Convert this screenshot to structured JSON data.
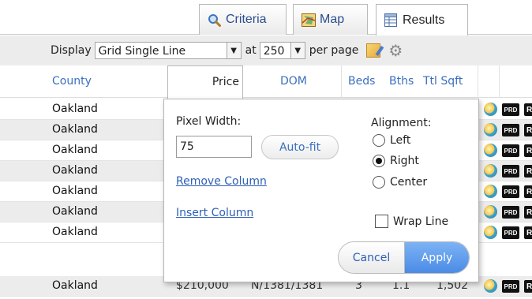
{
  "tabs": [
    {
      "label": "Criteria",
      "icon": "magnifier-icon"
    },
    {
      "label": "Map",
      "icon": "map-icon"
    },
    {
      "label": "Results",
      "icon": "table-icon"
    }
  ],
  "toolbar": {
    "display_label": "Display",
    "display_value": "Grid Single Line",
    "at_label": "at",
    "per_page_value": "250",
    "per_page_label": "per page"
  },
  "columns": {
    "county": "County",
    "price": "Price",
    "dom": "DOM",
    "beds": "Beds",
    "bths": "Bths",
    "ttl_sqft": "Ttl Sqft"
  },
  "rows": [
    {
      "county": "Oakland"
    },
    {
      "county": "Oakland"
    },
    {
      "county": "Oakland"
    },
    {
      "county": "Oakland"
    },
    {
      "county": "Oakland"
    },
    {
      "county": "Oakland"
    },
    {
      "county": "Oakland"
    },
    {
      "county": "Oakland",
      "price": "$210,000",
      "dom": "N/1381/1381",
      "beds": "3",
      "bths": "1.1",
      "ttl_sqft": "1,502"
    }
  ],
  "row_icons": {
    "prd_label": "PRD",
    "r_label": "R"
  },
  "popup": {
    "pixel_width_label": "Pixel Width:",
    "pixel_width_value": "75",
    "autofit_label": "Auto-fit",
    "remove_column_label": "Remove Column",
    "insert_column_label": "Insert Column",
    "alignment_label": "Alignment:",
    "alignment_options": [
      "Left",
      "Right",
      "Center"
    ],
    "alignment_selected": "Right",
    "wrap_line_label": "Wrap Line",
    "wrap_line_checked": false,
    "cancel_label": "Cancel",
    "apply_label": "Apply"
  },
  "colors": {
    "link": "#2e5fb6",
    "header_text": "#3b6fbf",
    "apply_button": "#4a8be6",
    "row_alt": "#ececec"
  }
}
